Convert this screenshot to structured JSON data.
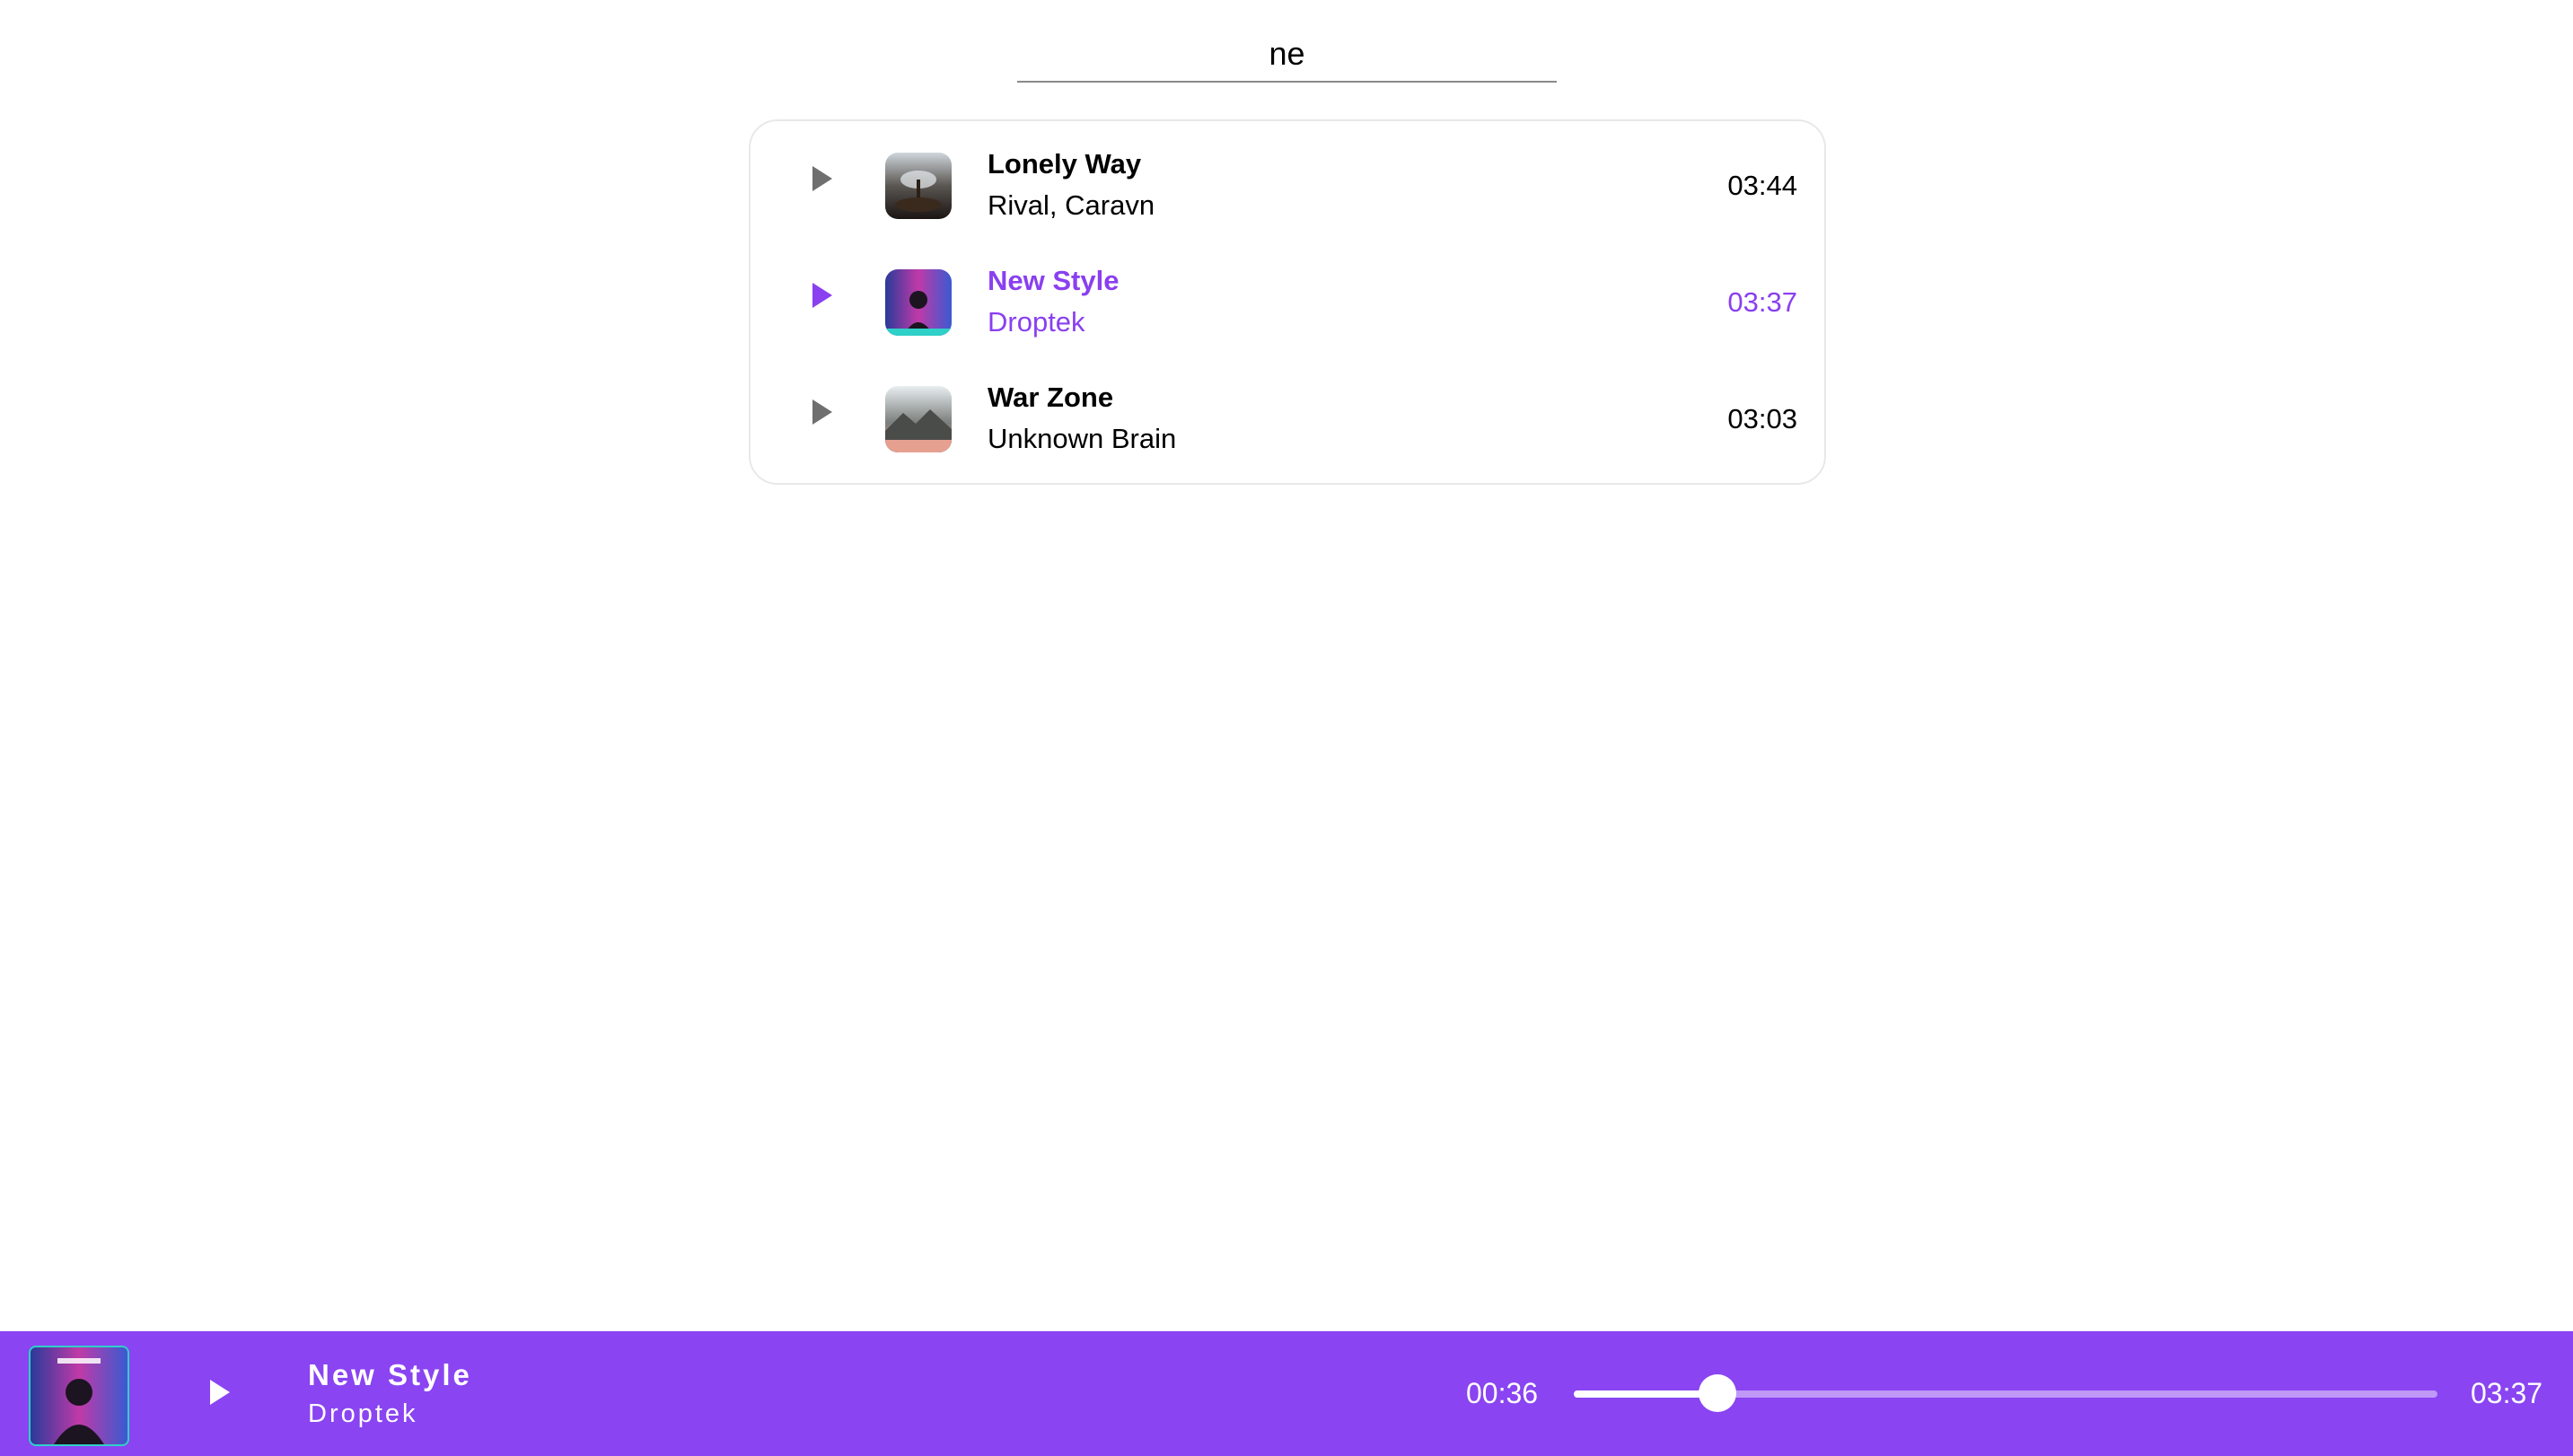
{
  "search": {
    "value": "ne"
  },
  "tracks": [
    {
      "title": "Lonely Way",
      "artist": "Rival, Caravn",
      "duration": "03:44",
      "active": false,
      "thumb_icon": "album-art-lonely-way"
    },
    {
      "title": "New Style",
      "artist": "Droptek",
      "duration": "03:37",
      "active": true,
      "thumb_icon": "album-art-new-style"
    },
    {
      "title": "War Zone",
      "artist": "Unknown Brain",
      "duration": "03:03",
      "active": false,
      "thumb_icon": "album-art-war-zone"
    }
  ],
  "player": {
    "title": "New Style",
    "artist": "Droptek",
    "current_time": "00:36",
    "total_time": "03:37",
    "progress": 0.166
  },
  "colors": {
    "accent": "#8a44f2",
    "active_text": "#8a3ff0",
    "inactive_icon": "#6f6f6f"
  }
}
